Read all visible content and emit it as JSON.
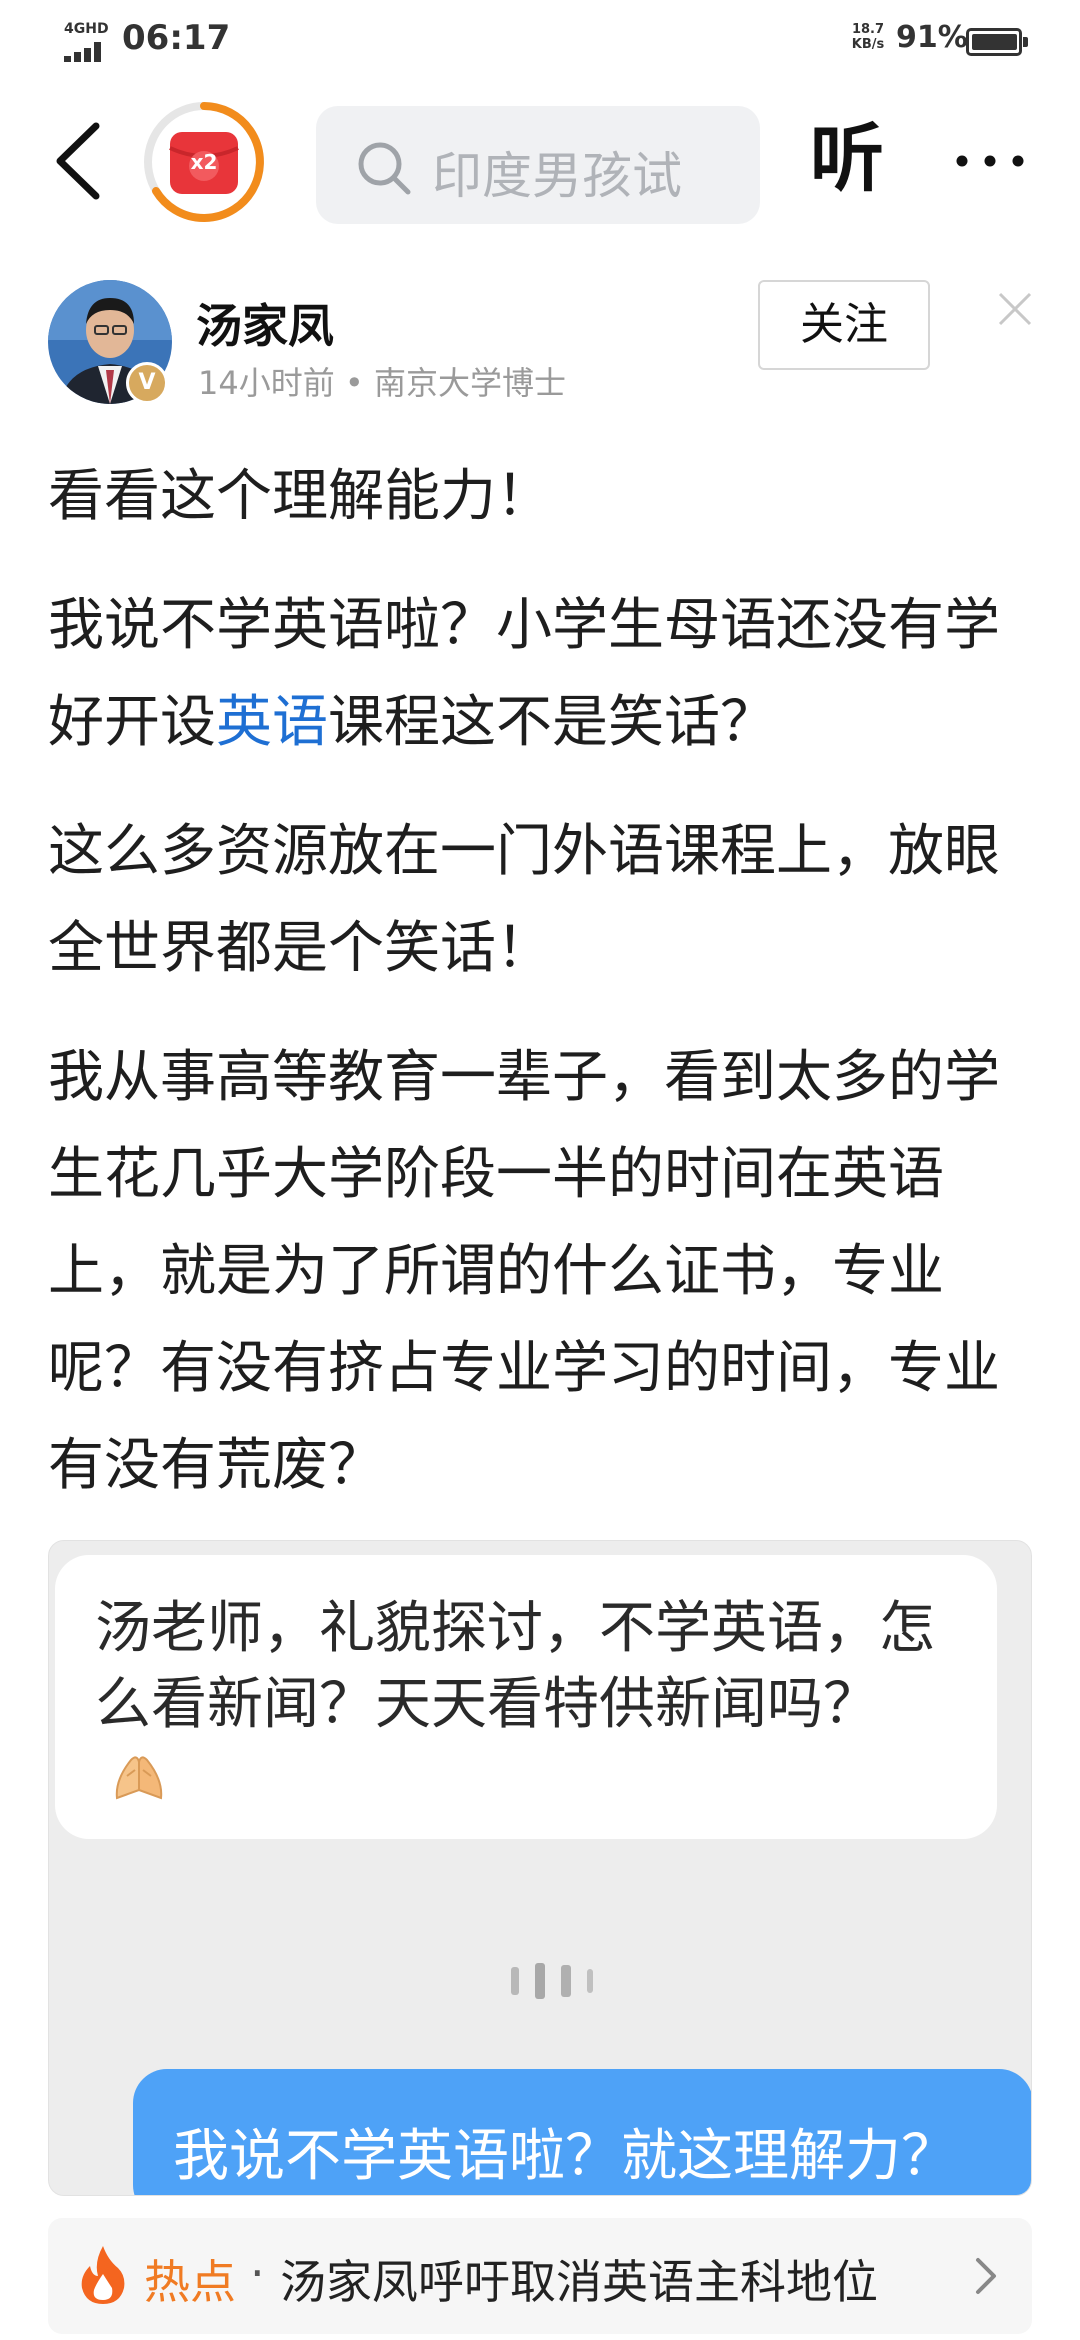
{
  "status_bar": {
    "network": "4GHD",
    "time": "06:17",
    "speed_value": "18.7",
    "speed_unit": "KB/s",
    "battery": "91%"
  },
  "nav": {
    "reward_badge": "x2",
    "search_placeholder": "印度男孩试",
    "listen_label": "听"
  },
  "author": {
    "name": "汤家凤",
    "meta": "14小时前 • 南京大学博士",
    "verified": "V",
    "follow_label": "关注"
  },
  "article": {
    "paragraphs": [
      "看看这个理解能力！",
      "我说不学英语啦？小学生母语还没有学好开设",
      "课程这不是笑话？",
      "这么多资源放在一门外语课程上，放眼全世界都是个笑话！",
      "我从事高等教育一辈子，看到太多的学生花几乎大学阶段一半的时间在英语上，就是为了所谓的什么证书，专业呢？有没有挤占专业学习的时间，专业有没有荒废？"
    ],
    "link_text": "英语"
  },
  "embed": {
    "incoming_message": "汤老师，礼貌探讨，不学英语，怎么看新闻？天天看特供新闻吗？",
    "emoji": "folded-hands",
    "outgoing_message": "我说不学英语啦？就这理解力？"
  },
  "hot_topic": {
    "label": "热点",
    "separator": "·",
    "title": "汤家凤呼吁取消英语主科地位"
  },
  "colors": {
    "link": "#1e6fd3",
    "hot": "#f07b23",
    "outgoing_bubble": "#4ea2f7",
    "reward_ring": "#f28c1c",
    "reward_red": "#e8353a"
  }
}
